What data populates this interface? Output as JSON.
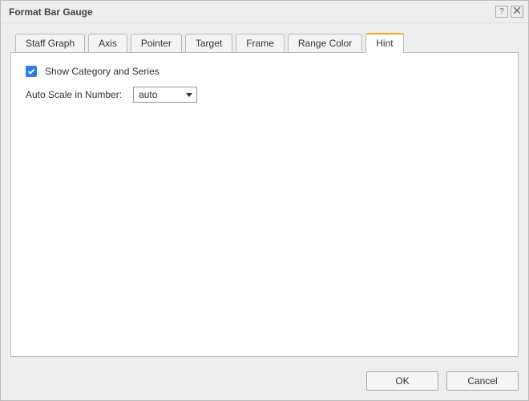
{
  "dialog": {
    "title": "Format Bar Gauge"
  },
  "tabs": {
    "items": [
      {
        "label": "Staff Graph"
      },
      {
        "label": "Axis"
      },
      {
        "label": "Pointer"
      },
      {
        "label": "Target"
      },
      {
        "label": "Frame"
      },
      {
        "label": "Range Color"
      },
      {
        "label": "Hint"
      }
    ],
    "activeIndex": 6
  },
  "hintPanel": {
    "showCategorySeries": {
      "label": "Show Category and Series",
      "checked": true
    },
    "autoScale": {
      "label": "Auto Scale in Number:",
      "value": "auto"
    }
  },
  "footer": {
    "ok": "OK",
    "cancel": "Cancel"
  }
}
